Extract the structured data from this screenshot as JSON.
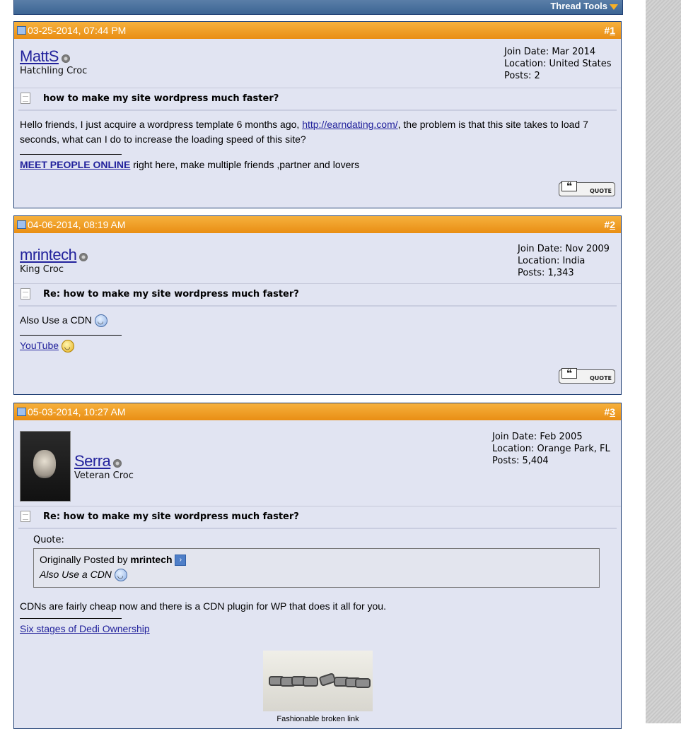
{
  "thread": {
    "tools_label": "Thread Tools"
  },
  "posts": [
    {
      "date": "03-25-2014, 07:44 PM",
      "num_prefix": "#",
      "num": "1",
      "username": "MattS",
      "user_title": "Hatchling Croc",
      "join_date": "Join Date: Mar 2014",
      "location": "Location: United States",
      "posts_count": "Posts: 2",
      "title": "how to make my site wordpress much faster?",
      "body_part1": "Hello friends, I just acquire a wordpress template 6 months ago, ",
      "body_link": "http://earndating.com/",
      "body_part2": ", the problem is that this site takes to load 7 seconds, what can I do to increase the loading speed of this site?",
      "sig_link": "MEET PEOPLE ONLINE",
      "sig_text": " right here, make multiple friends ,partner and lovers",
      "quote_label": "QUOTE"
    },
    {
      "date": "04-06-2014, 08:19 AM",
      "num_prefix": "#",
      "num": "2",
      "username": "mrintech",
      "user_title": "King Croc",
      "join_date": "Join Date: Nov 2009",
      "location": "Location: India",
      "posts_count": "Posts: 1,343",
      "title": "Re: how to make my site wordpress much faster?",
      "body": "Also Use a CDN",
      "sig_link": "YouTube",
      "quote_label": "QUOTE"
    },
    {
      "date": "05-03-2014, 10:27 AM",
      "num_prefix": "#",
      "num": "3",
      "username": "Serra",
      "user_title": "Veteran Croc",
      "join_date": "Join Date: Feb 2005",
      "location": "Location: Orange Park, FL",
      "posts_count": "Posts: 5,404",
      "title": "Re: how to make my site wordpress much faster?",
      "quote_label_text": "Quote:",
      "quote_prefix": "Originally Posted by ",
      "quote_author": "mrintech",
      "quote_text": "Also Use a CDN",
      "body": "CDNs are fairly cheap now and there is a CDN plugin for WP that does it all for you.",
      "sig_link": "Six stages of Dedi Ownership",
      "image_caption": "Fashionable broken link"
    }
  ]
}
